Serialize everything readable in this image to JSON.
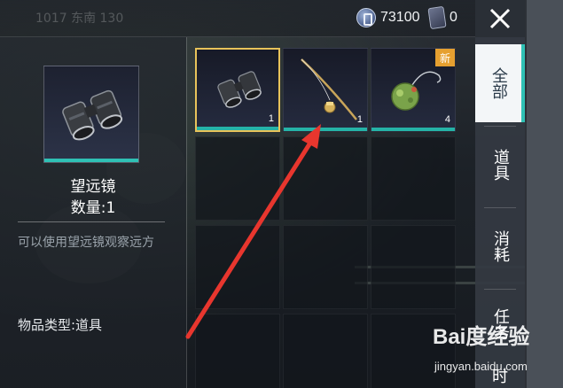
{
  "status_bar": {
    "faded_left": "1017   东南   130",
    "currency_amount": "73100",
    "ticket_amount": "0"
  },
  "detail": {
    "item_name": "望远镜",
    "quantity_text": "数量:1",
    "description": "可以使用望远镜观察远方",
    "type_text": "物品类型:道具"
  },
  "slots": [
    {
      "name": "binoculars",
      "count": "1",
      "selected": true,
      "badge": ""
    },
    {
      "name": "fishing-rod",
      "count": "1",
      "selected": false,
      "badge": ""
    },
    {
      "name": "fishing-bait",
      "count": "4",
      "selected": false,
      "badge": "新"
    }
  ],
  "tabs": [
    {
      "label": "全部",
      "active": true
    },
    {
      "label": "道具",
      "active": false
    },
    {
      "label": "消耗",
      "active": false
    },
    {
      "label": "任务",
      "active": false
    },
    {
      "label": "时",
      "active": false
    }
  ],
  "watermark": {
    "logo": "Bai度经验",
    "url": "jingyan.baidu.com"
  },
  "colors": {
    "accent_teal": "#2fc1b5",
    "selected_border": "#e8c35a",
    "new_badge": "#e6a030",
    "arrow": "#e8362e"
  }
}
